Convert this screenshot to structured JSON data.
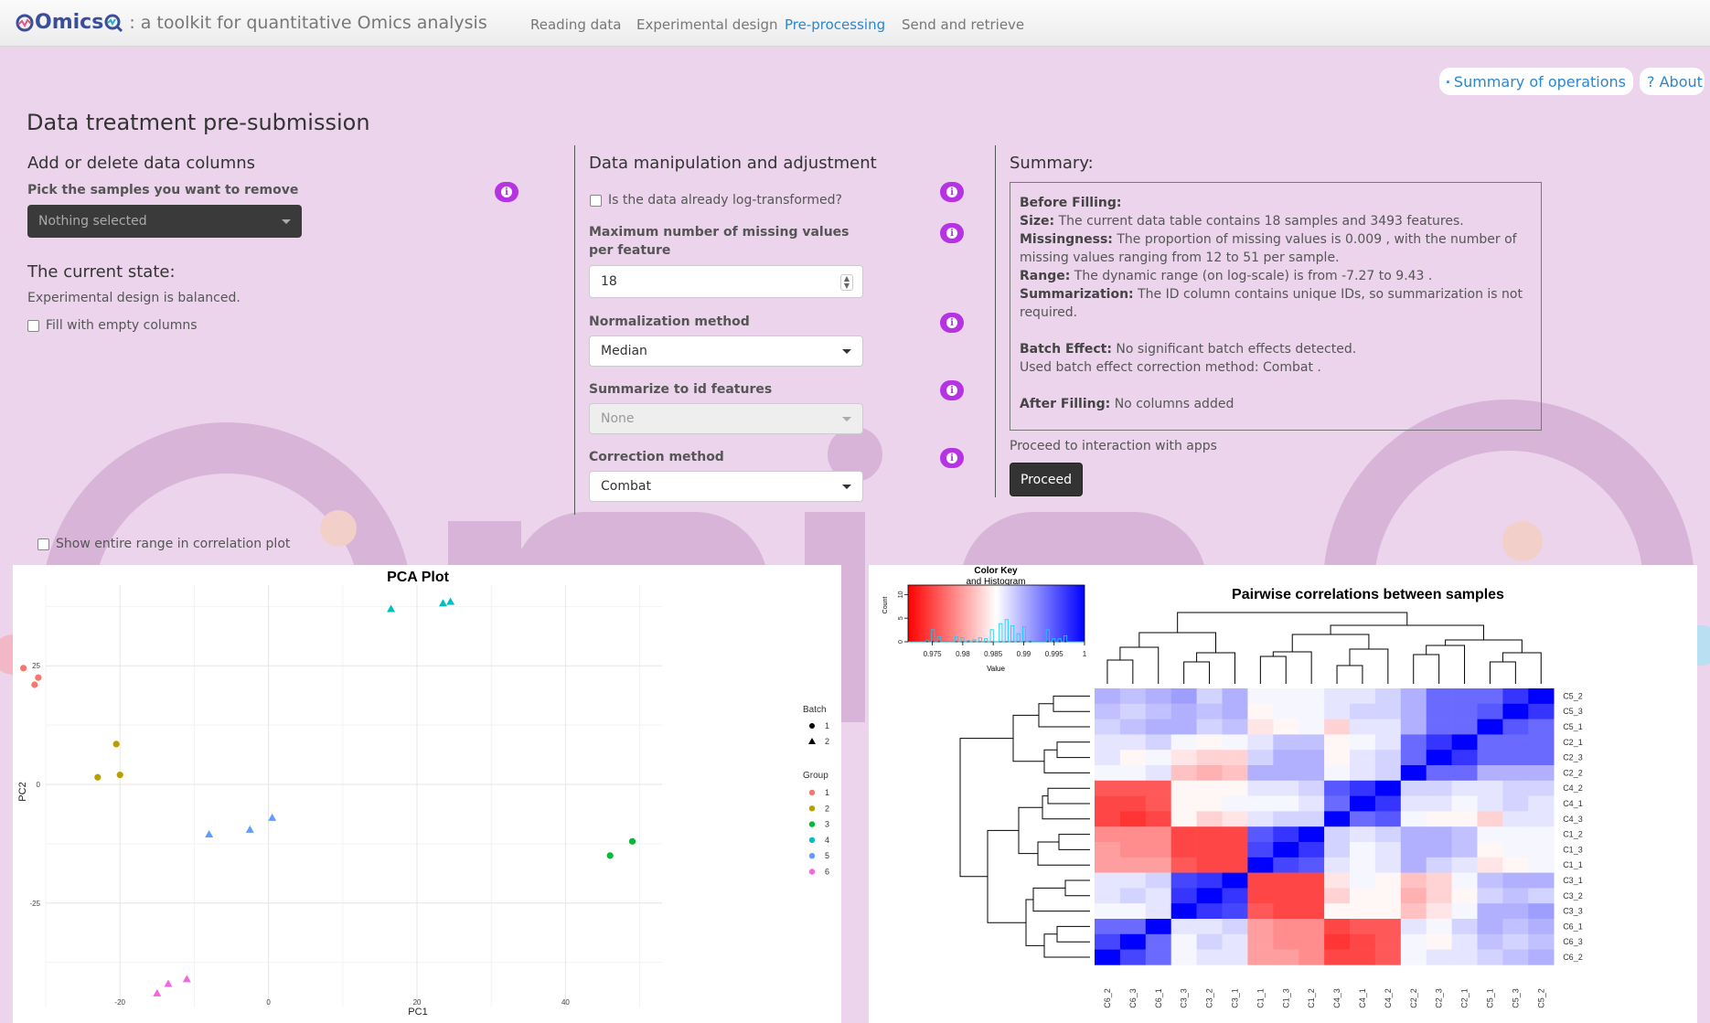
{
  "brand": {
    "logo_text": "Omics",
    "tagline": ": a toolkit for quantitative Omics analysis"
  },
  "nav": [
    {
      "label": "Reading data",
      "active": false
    },
    {
      "label": "Experimental design",
      "active": false
    },
    {
      "label": "Pre-processing",
      "active": true
    },
    {
      "label": "Send and retrieve",
      "active": false
    }
  ],
  "top_links": {
    "summary": "Summary of operations",
    "about": "About"
  },
  "page_title": "Data treatment pre-submission",
  "left": {
    "heading": "Add or delete data columns",
    "remove_label": "Pick the samples you want to remove",
    "remove_placeholder": "Nothing selected",
    "state_heading": "The current state:",
    "state_text": "Experimental design is balanced.",
    "fill_empty_label": "Fill with empty columns",
    "show_range_label": "Show entire range in correlation plot"
  },
  "middle": {
    "heading": "Data manipulation and adjustment",
    "log_label": "Is the data already log-transformed?",
    "max_missing_label": "Maximum number of missing values per feature",
    "max_missing_value": "18",
    "norm_label": "Normalization method",
    "norm_value": "Median",
    "summ_label": "Summarize to id features",
    "summ_value": "None",
    "corr_label": "Correction method",
    "corr_value": "Combat"
  },
  "summary": {
    "heading": "Summary:",
    "before_filling": "Before Filling:",
    "size_label": "Size:",
    "size_text": "The current data table contains 18 samples and 3493 features.",
    "missing_label": "Missingness:",
    "missing_text": "The proportion of missing values is 0.009 , with the number of missing values ranging from 12 to 51 per sample.",
    "range_label": "Range:",
    "range_text": "The dynamic range (on log-scale) is from -7.27 to 9.43 .",
    "summ_label": "Summarization:",
    "summ_text": "The ID column contains unique IDs, so summarization is not required.",
    "batch_label": "Batch Effect:",
    "batch_text": "No significant batch effects detected.",
    "batch_method": "Used batch effect correction method: Combat .",
    "after_label": "After Filling:",
    "after_text": "No columns added",
    "proceed_text": "Proceed to interaction with apps",
    "proceed_button": "Proceed"
  },
  "colors": {
    "accent": "#b633e4",
    "link": "#2a86d0",
    "background": "#ecd5ec",
    "group_colors": [
      "#f8766d",
      "#b79f00",
      "#00ba38",
      "#00bfc4",
      "#619cff",
      "#f564e3"
    ]
  },
  "chart_data": [
    {
      "type": "scatter",
      "title": "PCA Plot",
      "xlabel": "PC1",
      "ylabel": "PC2",
      "xlim": [
        -30,
        53
      ],
      "ylim": [
        -47,
        42
      ],
      "xticks": [
        -20,
        0,
        20,
        40
      ],
      "yticks": [
        25,
        0,
        -25
      ],
      "grid": true,
      "legend_batch": {
        "title": "Batch",
        "entries": [
          "1",
          "2"
        ]
      },
      "legend_group": {
        "title": "Group",
        "entries": [
          "1",
          "2",
          "3",
          "4",
          "5",
          "6"
        ]
      },
      "points": [
        {
          "x": -33,
          "y": 24.5,
          "group": 1,
          "batch": 1
        },
        {
          "x": -31,
          "y": 22.5,
          "group": 1,
          "batch": 1
        },
        {
          "x": -31.5,
          "y": 21,
          "group": 1,
          "batch": 1
        },
        {
          "x": -20.5,
          "y": 8.5,
          "group": 2,
          "batch": 1
        },
        {
          "x": -23,
          "y": 1.5,
          "group": 2,
          "batch": 1
        },
        {
          "x": -20,
          "y": 2,
          "group": 2,
          "batch": 1
        },
        {
          "x": 46,
          "y": -15,
          "group": 3,
          "batch": 1
        },
        {
          "x": 49,
          "y": -12,
          "group": 3,
          "batch": 1
        },
        {
          "x": 16.5,
          "y": 37,
          "group": 4,
          "batch": 2
        },
        {
          "x": 23.5,
          "y": 38.2,
          "group": 4,
          "batch": 2
        },
        {
          "x": 24.5,
          "y": 38.5,
          "group": 4,
          "batch": 2
        },
        {
          "x": -8,
          "y": -10.5,
          "group": 5,
          "batch": 2
        },
        {
          "x": -2.5,
          "y": -9.5,
          "group": 5,
          "batch": 2
        },
        {
          "x": 0.5,
          "y": -7,
          "group": 5,
          "batch": 2
        },
        {
          "x": -15,
          "y": -44,
          "group": 6,
          "batch": 2
        },
        {
          "x": -13.5,
          "y": -42,
          "group": 6,
          "batch": 2
        },
        {
          "x": -11,
          "y": -41,
          "group": 6,
          "batch": 2
        }
      ]
    },
    {
      "type": "heatmap",
      "title": "Pairwise correlations between samples",
      "color_key": {
        "title_line1": "Color Key",
        "title_line2": "and Histogram",
        "xlabel": "Value",
        "ylabel": "Count",
        "y_ticks": [
          "0",
          "5",
          "10"
        ],
        "ticks": [
          "0.975",
          "0.98",
          "0.985",
          "0.99",
          "0.995",
          "1"
        ],
        "range": [
          0.971,
          1.0
        ]
      },
      "columns": [
        "C6_2",
        "C6_3",
        "C6_1",
        "C3_3",
        "C3_2",
        "C3_1",
        "C1_1",
        "C1_3",
        "C1_2",
        "C4_3",
        "C4_1",
        "C4_2",
        "C2_2",
        "C2_3",
        "C2_1",
        "C5_1",
        "C5_3",
        "C5_2"
      ],
      "rows": [
        "C5_2",
        "C5_3",
        "C5_1",
        "C2_1",
        "C2_3",
        "C2_2",
        "C4_2",
        "C4_1",
        "C4_3",
        "C1_2",
        "C1_3",
        "C1_1",
        "C3_1",
        "C3_2",
        "C3_3",
        "C6_1",
        "C6_3",
        "C6_2"
      ],
      "values": [
        [
          0.99,
          0.989,
          0.99,
          0.991,
          0.988,
          0.99,
          0.986,
          0.986,
          0.986,
          0.987,
          0.987,
          0.988,
          0.99,
          0.994,
          0.994,
          0.994,
          0.997,
          1.0
        ],
        [
          0.989,
          0.988,
          0.989,
          0.99,
          0.989,
          0.99,
          0.985,
          0.986,
          0.986,
          0.987,
          0.988,
          0.988,
          0.99,
          0.994,
          0.994,
          0.995,
          1.0,
          0.997
        ],
        [
          0.988,
          0.989,
          0.99,
          0.99,
          0.988,
          0.989,
          0.984,
          0.985,
          0.986,
          0.983,
          0.987,
          0.987,
          0.99,
          0.994,
          0.994,
          1.0,
          0.995,
          0.994
        ],
        [
          0.987,
          0.987,
          0.988,
          0.986,
          0.985,
          0.986,
          0.987,
          0.989,
          0.989,
          0.985,
          0.986,
          0.987,
          0.994,
          0.997,
          1.0,
          0.994,
          0.994,
          0.994
        ],
        [
          0.987,
          0.985,
          0.986,
          0.984,
          0.983,
          0.983,
          0.988,
          0.99,
          0.99,
          0.985,
          0.987,
          0.988,
          0.994,
          1.0,
          0.997,
          0.994,
          0.994,
          0.994
        ],
        [
          0.986,
          0.986,
          0.987,
          0.982,
          0.981,
          0.982,
          0.99,
          0.99,
          0.99,
          0.986,
          0.987,
          0.988,
          1.0,
          0.994,
          0.994,
          0.99,
          0.99,
          0.99
        ],
        [
          0.976,
          0.976,
          0.976,
          0.985,
          0.985,
          0.985,
          0.987,
          0.987,
          0.988,
          0.995,
          0.997,
          1.0,
          0.988,
          0.988,
          0.987,
          0.987,
          0.988,
          0.988
        ],
        [
          0.975,
          0.975,
          0.976,
          0.985,
          0.985,
          0.986,
          0.986,
          0.986,
          0.987,
          0.994,
          1.0,
          0.997,
          0.987,
          0.987,
          0.986,
          0.987,
          0.988,
          0.987
        ],
        [
          0.975,
          0.974,
          0.975,
          0.985,
          0.983,
          0.984,
          0.987,
          0.988,
          0.988,
          1.0,
          0.994,
          0.995,
          0.986,
          0.985,
          0.985,
          0.983,
          0.987,
          0.987
        ],
        [
          0.979,
          0.979,
          0.979,
          0.975,
          0.975,
          0.975,
          0.995,
          0.997,
          1.0,
          0.988,
          0.987,
          0.988,
          0.99,
          0.99,
          0.989,
          0.986,
          0.986,
          0.986
        ],
        [
          0.98,
          0.979,
          0.979,
          0.975,
          0.975,
          0.975,
          0.996,
          1.0,
          0.997,
          0.988,
          0.986,
          0.987,
          0.99,
          0.99,
          0.989,
          0.985,
          0.986,
          0.986
        ],
        [
          0.98,
          0.98,
          0.98,
          0.976,
          0.975,
          0.975,
          1.0,
          0.996,
          0.995,
          0.987,
          0.986,
          0.987,
          0.99,
          0.988,
          0.987,
          0.984,
          0.985,
          0.986
        ],
        [
          0.987,
          0.987,
          0.988,
          0.996,
          0.997,
          1.0,
          0.975,
          0.975,
          0.975,
          0.984,
          0.986,
          0.985,
          0.982,
          0.983,
          0.986,
          0.989,
          0.99,
          0.99
        ],
        [
          0.987,
          0.988,
          0.987,
          0.997,
          1.0,
          0.997,
          0.975,
          0.975,
          0.975,
          0.983,
          0.985,
          0.985,
          0.981,
          0.983,
          0.985,
          0.988,
          0.989,
          0.988
        ],
        [
          0.986,
          0.986,
          0.987,
          1.0,
          0.997,
          0.996,
          0.976,
          0.975,
          0.975,
          0.985,
          0.985,
          0.985,
          0.982,
          0.984,
          0.986,
          0.99,
          0.99,
          0.991
        ],
        [
          0.994,
          0.994,
          1.0,
          0.987,
          0.987,
          0.988,
          0.98,
          0.979,
          0.979,
          0.975,
          0.976,
          0.976,
          0.987,
          0.986,
          0.988,
          0.99,
          0.989,
          0.99
        ],
        [
          0.996,
          1.0,
          0.994,
          0.986,
          0.988,
          0.987,
          0.98,
          0.979,
          0.979,
          0.974,
          0.975,
          0.976,
          0.986,
          0.985,
          0.987,
          0.989,
          0.988,
          0.989
        ],
        [
          1.0,
          0.996,
          0.994,
          0.986,
          0.987,
          0.987,
          0.98,
          0.98,
          0.979,
          0.975,
          0.975,
          0.976,
          0.986,
          0.987,
          0.987,
          0.988,
          0.989,
          0.99
        ]
      ]
    }
  ]
}
